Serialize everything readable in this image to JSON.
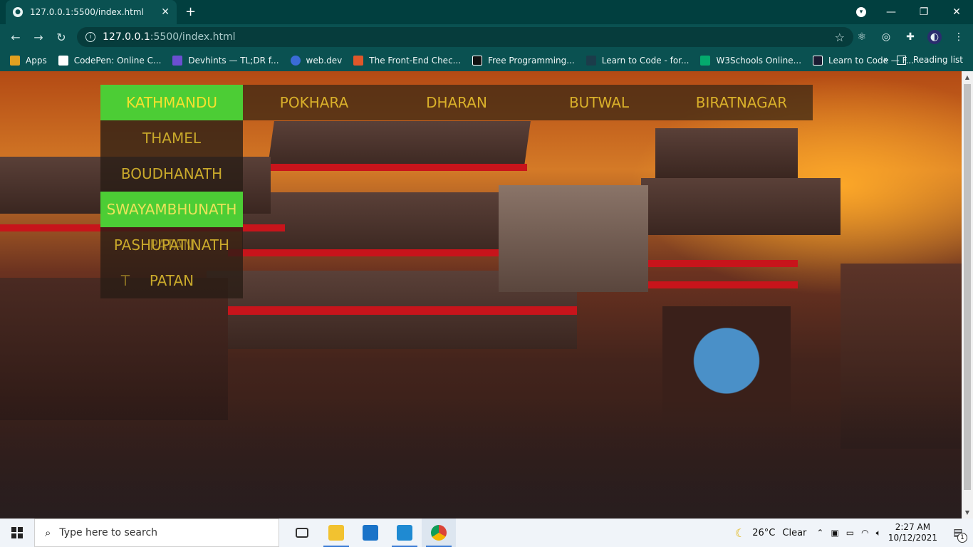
{
  "browser": {
    "tab_title": "127.0.0.1:5500/index.html",
    "url_host": "127.0.0.1",
    "url_path": ":5500/index.html",
    "bookmarks": [
      {
        "label": "Apps",
        "color": "#e0a020"
      },
      {
        "label": "CodePen: Online C...",
        "color": "#ffffff"
      },
      {
        "label": "Devhints — TL;DR f...",
        "color": "#6b4fd1"
      },
      {
        "label": "web.dev",
        "color": "#3b6bd6"
      },
      {
        "label": "The Front-End Chec...",
        "color": "#e0572a"
      },
      {
        "label": "Free Programming...",
        "color": "#111111"
      },
      {
        "label": "Learn to Code - for...",
        "color": "#1b3c4a"
      },
      {
        "label": "W3Schools Online...",
        "color": "#04aa6d"
      },
      {
        "label": "Learn to Code — F...",
        "color": "#1b1b32"
      }
    ],
    "more_bookmarks": "»",
    "reading_list": "Reading list"
  },
  "page": {
    "nav": [
      {
        "label": "KATHMANDU",
        "active": true
      },
      {
        "label": "POKHARA",
        "active": false
      },
      {
        "label": "DHARAN",
        "active": false
      },
      {
        "label": "BUTWAL",
        "active": false
      },
      {
        "label": "BIRATNAGAR",
        "active": false
      }
    ],
    "dropdown": [
      {
        "label": "THAMEL",
        "active": false
      },
      {
        "label": "BOUDHANATH",
        "active": false
      },
      {
        "label": "SWAYAMBHUNATH",
        "active": true
      },
      {
        "label": "PASHUPATINATH",
        "active": false
      },
      {
        "label": "PATAN",
        "active": false
      }
    ],
    "dropdown_ghosts": {
      "row4": "PATAN",
      "row5": "T"
    },
    "accent_color": "#4ccd35",
    "nav_text_color": "#d9b02a"
  },
  "taskbar": {
    "search_placeholder": "Type here to search",
    "weather_temp": "26°C",
    "weather_cond": "Clear",
    "time": "2:27 AM",
    "date": "10/12/2021",
    "notification_count": "1"
  }
}
